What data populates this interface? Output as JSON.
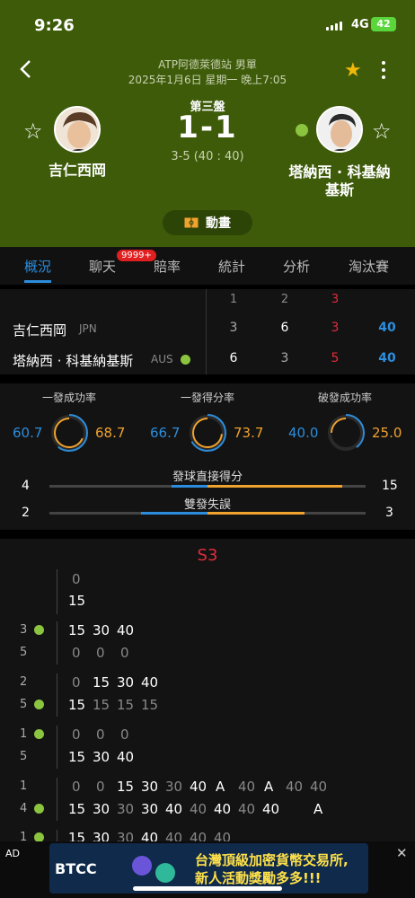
{
  "status": {
    "time": "9:26",
    "network": "4G",
    "battery": "42"
  },
  "match": {
    "league": "ATP阿德萊德站 男單",
    "date": "2025年1月6日 星期一 晚上7:05",
    "set_label": "第三盤",
    "score": "1-1",
    "game_score": "3-5 (40 : 40)"
  },
  "players": {
    "p1": {
      "name": "吉仁西岡",
      "country": "JPN"
    },
    "p2": {
      "name_line1": "塔納西 · 科基納",
      "name_line2": "基斯",
      "name": "塔納西 · 科基納基斯",
      "country": "AUS"
    }
  },
  "animation_label": "動畫",
  "tabs": [
    "概況",
    "聊天",
    "賠率",
    "統計",
    "分析",
    "淘汰賽"
  ],
  "chat_badge": "9999+",
  "set_table": {
    "headers": [
      "1",
      "2",
      "3"
    ],
    "p1": [
      "3",
      "6",
      "3",
      "40"
    ],
    "p2": [
      "6",
      "3",
      "5",
      "40"
    ]
  },
  "ring_stats": [
    {
      "label": "一發成功率",
      "left": "60.7",
      "right": "68.7"
    },
    {
      "label": "一發得分率",
      "left": "66.7",
      "right": "73.7"
    },
    {
      "label": "破發成功率",
      "left": "40.0",
      "right": "25.0"
    }
  ],
  "bar_stats": [
    {
      "label": "發球直接得分",
      "left": "4",
      "right": "15"
    },
    {
      "label": "雙發失誤",
      "left": "2",
      "right": "3"
    }
  ],
  "s3": {
    "title": "S3",
    "r0": {
      "top": "0",
      "bottom": "15"
    },
    "g1": {
      "top_num": "3",
      "bot_num": "5",
      "top": [
        "15",
        "30",
        "40"
      ],
      "bot": [
        "0",
        "0",
        "0"
      ]
    },
    "g2": {
      "top_num": "2",
      "bot_num": "5",
      "top": [
        "0",
        "15",
        "30",
        "40"
      ],
      "bot": [
        "15",
        "15",
        "15",
        "15"
      ]
    },
    "g3": {
      "top_num": "1",
      "bot_num": "5",
      "top": [
        "0",
        "0",
        "0"
      ],
      "bot": [
        "15",
        "30",
        "40"
      ]
    },
    "g4": {
      "top_num": "1",
      "bot_num": "4",
      "top": [
        "0",
        "0",
        "15",
        "30",
        "30",
        "40",
        "A",
        "40",
        "A",
        "40",
        "40"
      ],
      "bot": [
        "15",
        "30",
        "30",
        "30",
        "40",
        "40",
        "40",
        "40",
        "40",
        "A"
      ]
    },
    "g5": {
      "top_num": "1",
      "top": [
        "15",
        "30",
        "30",
        "40",
        "40",
        "40",
        "40"
      ]
    }
  },
  "ad": {
    "label": "AD",
    "brand": "BTCC",
    "text1": "台灣頂級加密貨幣交易所,",
    "text2": "新人活動獎勵多多!!!"
  },
  "colors": {
    "header": "#3e5b0a",
    "accent": "#2c8ddc",
    "orange": "#f0a22e",
    "red": "#e02c3c",
    "serve": "#8bc53f",
    "fav_star": "#f2b807"
  }
}
